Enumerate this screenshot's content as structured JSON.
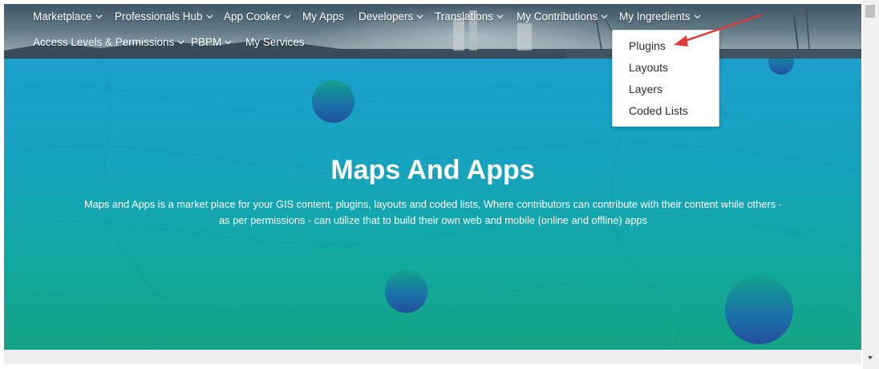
{
  "nav": {
    "row1": [
      {
        "label": "Marketplace",
        "dropdown": true
      },
      {
        "label": "Professionals Hub",
        "dropdown": true
      },
      {
        "label": "App Cooker",
        "dropdown": true
      },
      {
        "label": "My Apps",
        "dropdown": false
      },
      {
        "label": "Developers",
        "dropdown": true
      },
      {
        "label": "Translations",
        "dropdown": true
      },
      {
        "label": "My Contributions",
        "dropdown": true
      },
      {
        "label": "My Ingredients",
        "dropdown": true
      }
    ],
    "row2": [
      {
        "label": "Access Levels & Permissions",
        "dropdown": true
      },
      {
        "label": "PBPM",
        "dropdown": true
      },
      {
        "label": "My Services",
        "dropdown": false
      }
    ]
  },
  "dropdown_menu": {
    "parent": "My Ingredients",
    "items": [
      "Plugins",
      "Layouts",
      "Layers",
      "Coded Lists"
    ]
  },
  "hero": {
    "title": "Maps And Apps",
    "description": "Maps and Apps is a market place for your GIS content, plugins, layouts and coded lists, Where contributors can contribute with their content while others - as per permissions - can utilize that to build their own web and mobile (online and offline) apps"
  },
  "annotation": {
    "arrow_color": "#e03a3a",
    "points_to": "Plugins"
  },
  "colors": {
    "hero_top": "#1c9fcc",
    "hero_bottom": "#14a383",
    "nav_text": "#ffffff"
  }
}
